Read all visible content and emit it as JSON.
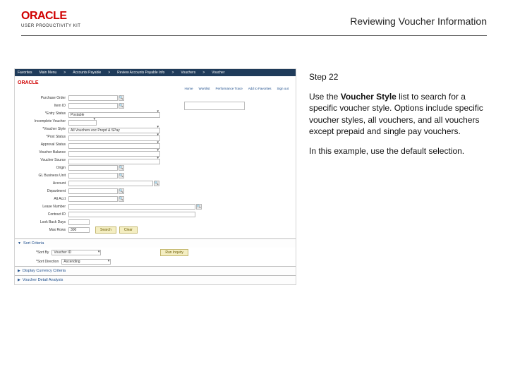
{
  "header": {
    "brand_main": "ORACLE",
    "brand_sub": "USER PRODUCTIVITY KIT",
    "title": "Reviewing Voucher Information"
  },
  "instructions": {
    "step": "Step 22",
    "p1a": "Use the ",
    "p1b": "Voucher Style",
    "p1c": " list to search for a specific voucher style. Options include specific voucher styles, all vouchers, and all vouchers except prepaid and single pay vouchers.",
    "p2": "In this example, use the default selection."
  },
  "shot": {
    "tabs": {
      "favorites": "Favorites",
      "main": "Main Menu",
      "ap": "Accounts Payable",
      "rap": "Review Accounts Payable Info",
      "vouchers": "Vouchers",
      "voucher": "Voucher"
    },
    "brand": "ORACLE",
    "links": {
      "home": "Home",
      "worklist": "Worklist",
      "perf": "Performance Trace",
      "addfav": "Add to Favorites",
      "signout": "Sign out"
    },
    "form": {
      "po_label": "Purchase Order",
      "item_label": "Item ID",
      "entry_label": "*Entry Status",
      "entry_value": "Postable",
      "incomplete_label": "Incomplete Voucher",
      "vstyle_label": "*Voucher Style",
      "vstyle_value": "All Vouchers exc Prepd & SPay",
      "post_label": "*Post Status",
      "approval_label": "Approval Status",
      "vbalance_label": "Voucher Balance",
      "vsource_label": "Voucher Source",
      "origin_label": "Origin",
      "glunit_label": "GL Business Unit",
      "account_label": "Account",
      "dept_label": "Department",
      "altacct_label": "Alt Acct",
      "lease_label": "Lease Number",
      "contract_label": "Contract ID",
      "lookback_label": "Look Back Days",
      "maxrows_label": "Max Rows",
      "maxrows_value": "300",
      "search_btn": "Search",
      "clear_btn": "Clear"
    },
    "sections": {
      "sort": "Sort Criteria",
      "sortby_label": "*Sort By",
      "sortby_value": "Voucher ID",
      "sortorder_label": "*Sort Direction",
      "sortorder_value": "Ascending",
      "run_btn": "Run Inquiry",
      "display": "Display Currency Criteria",
      "detail": "Voucher Detail Analysis"
    }
  }
}
